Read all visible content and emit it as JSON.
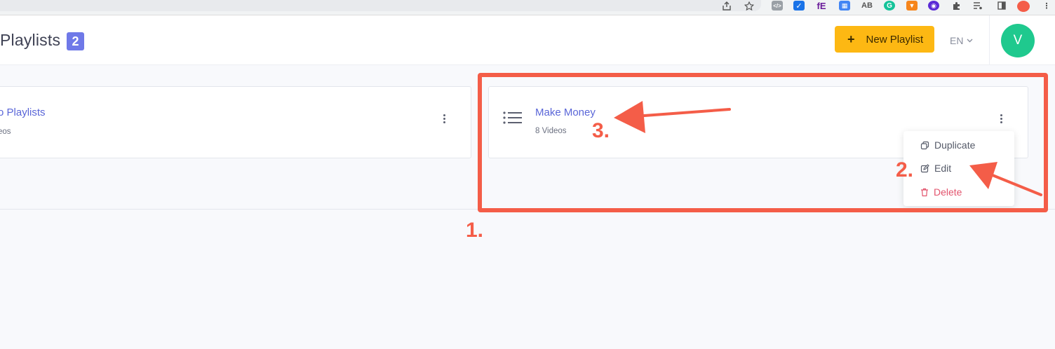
{
  "header": {
    "title": "Playlists",
    "count": "2",
    "new_playlist_label": "New Playlist",
    "new_playlist_plus": "+",
    "language": "EN",
    "avatar_initial": "V"
  },
  "playlists": [
    {
      "title": "o Playlists",
      "subtitle": "eos"
    },
    {
      "title": "Make Money",
      "subtitle": "8 Videos"
    }
  ],
  "menu": {
    "duplicate": "Duplicate",
    "edit": "Edit",
    "delete": "Delete"
  },
  "annotations": {
    "step1": "1.",
    "step2": "2.",
    "step3": "3."
  },
  "extensions": [
    "AB"
  ],
  "colors": {
    "accent": "#6f79e8",
    "link": "#5a66d8",
    "primary_button": "#fdb813",
    "avatar": "#1fc98e",
    "danger": "#e2546d",
    "annotation": "#f45d48"
  }
}
